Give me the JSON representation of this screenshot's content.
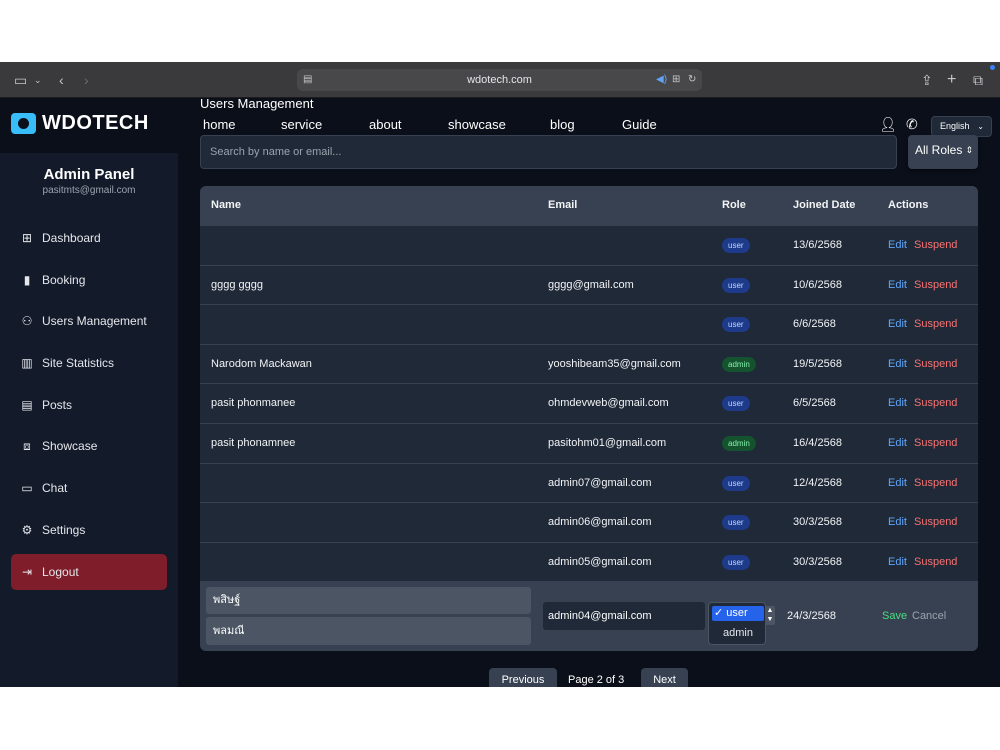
{
  "browser": {
    "url": "wdotech.com"
  },
  "brand": {
    "logo_text": "WDOTECH"
  },
  "sidebar": {
    "title": "Admin Panel",
    "email": "pasitmts@gmail.com",
    "items": [
      {
        "label": "Dashboard",
        "icon": "grid-icon"
      },
      {
        "label": "Booking",
        "icon": "book-icon"
      },
      {
        "label": "Users Management",
        "icon": "users-icon"
      },
      {
        "label": "Site Statistics",
        "icon": "bar-chart-icon"
      },
      {
        "label": "Posts",
        "icon": "document-icon"
      },
      {
        "label": "Showcase",
        "icon": "image-icon"
      },
      {
        "label": "Chat",
        "icon": "chat-icon"
      },
      {
        "label": "Settings",
        "icon": "gear-icon"
      },
      {
        "label": "Logout",
        "icon": "logout-icon"
      }
    ]
  },
  "header": {
    "title": "Users Management",
    "nav": [
      "home",
      "service",
      "about",
      "showcase",
      "blog",
      "Guide"
    ],
    "language": "English"
  },
  "filters": {
    "search_placeholder": "Search by name or email...",
    "role_filter": "All Roles"
  },
  "table": {
    "columns": [
      "Name",
      "Email",
      "Role",
      "Joined Date",
      "Actions"
    ],
    "rows": [
      {
        "name": "",
        "email": "",
        "role": "user",
        "joined": "13/6/2568"
      },
      {
        "name": "gggg gggg",
        "email": "gggg@gmail.com",
        "role": "user",
        "joined": "10/6/2568"
      },
      {
        "name": "",
        "email": "",
        "role": "user",
        "joined": "6/6/2568"
      },
      {
        "name": "Narodom Mackawan",
        "email": "yooshibeam35@gmail.com",
        "role": "admin",
        "joined": "19/5/2568"
      },
      {
        "name": "pasit phonmanee",
        "email": "ohmdevweb@gmail.com",
        "role": "user",
        "joined": "6/5/2568"
      },
      {
        "name": "pasit phonamnee",
        "email": "pasitohm01@gmail.com",
        "role": "admin",
        "joined": "16/4/2568"
      },
      {
        "name": "",
        "email": "admin07@gmail.com",
        "role": "user",
        "joined": "12/4/2568"
      },
      {
        "name": "",
        "email": "admin06@gmail.com",
        "role": "user",
        "joined": "30/3/2568"
      },
      {
        "name": "",
        "email": "admin05@gmail.com",
        "role": "user",
        "joined": "30/3/2568"
      }
    ],
    "edit_label": "Edit",
    "suspend_label": "Suspend",
    "editing_row": {
      "first_name": "พสิษฐ์",
      "last_name": "พลมณี",
      "email": "admin04@gmail.com",
      "role_options": [
        "✓ user",
        "admin"
      ],
      "joined": "24/3/2568",
      "save_label": "Save",
      "cancel_label": "Cancel"
    }
  },
  "pagination": {
    "previous": "Previous",
    "status": "Page 2 of 3",
    "next": "Next"
  }
}
